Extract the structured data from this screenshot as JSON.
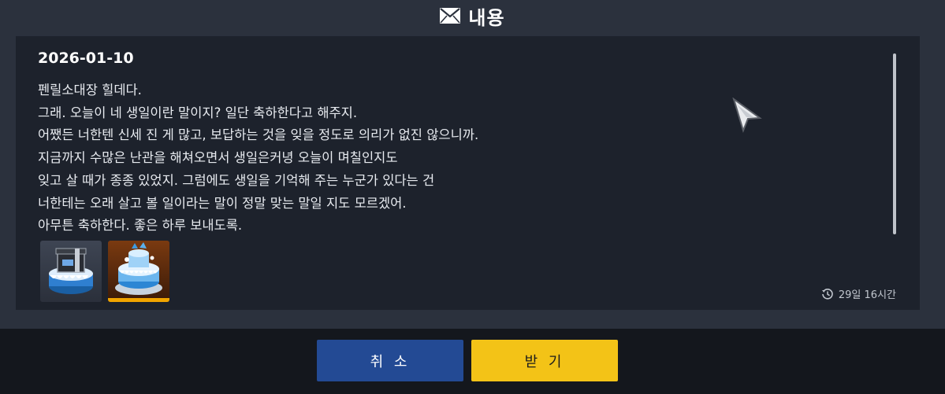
{
  "dialog": {
    "title": "내용",
    "title_icon": "envelope-icon"
  },
  "mail": {
    "date": "2026-01-10",
    "lines": [
      "펜릴소대장 힐데다.",
      "그래. 오늘이 네 생일이란 말이지? 일단 축하한다고 해주지.",
      "어쨌든 너한텐 신세 진 게 많고, 보답하는 것을 잊을 정도로 의리가 없진 않으니까.",
      "지금까지 수많은 난관을 해쳐오면서 생일은커녕 오늘이 며칠인지도",
      "잊고 살 때가 종종 있었지. 그럼에도 생일을 기억해 주는 누군가 있다는 건",
      "너한테는 오래 살고 볼 일이라는 말이 정말 맞는 말일 지도 모르겠어.",
      "아무튼 축하한다. 좋은 하루 보내도록."
    ],
    "attachments": [
      {
        "icon": "gift-cake-icon",
        "rarity_color": "#3e4553"
      },
      {
        "icon": "blue-cake-icon",
        "rarity_color": "#f0a400"
      }
    ],
    "expiry": "29일 16시간"
  },
  "buttons": {
    "cancel": "취 소",
    "receive": "받 기"
  },
  "colors": {
    "cancel_button": "#234a94",
    "receive_button": "#f3c317",
    "panel": "#1d222c",
    "background": "#2b313d"
  }
}
